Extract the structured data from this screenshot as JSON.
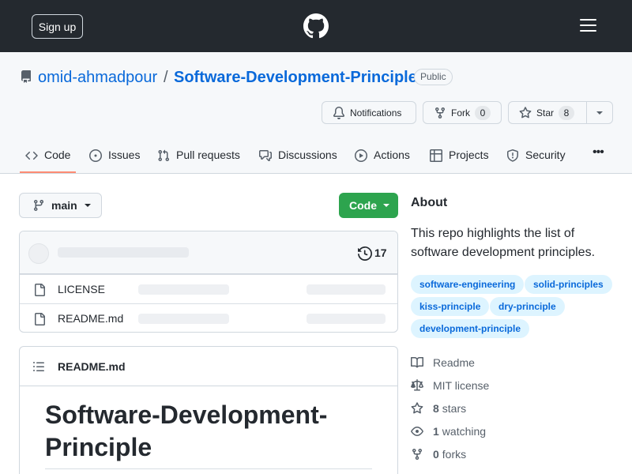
{
  "header": {
    "signup_label": "Sign up",
    "logo_icon": "github-mark-icon",
    "menu_icon": "hamburger-icon"
  },
  "repo": {
    "owner": "omid-ahmadpour",
    "separator": "/",
    "name": "Software-Development-Principle",
    "visibility": "Public"
  },
  "actions": {
    "notifications_label": "Notifications",
    "fork_label": "Fork",
    "fork_count": "0",
    "star_label": "Star",
    "star_count": "8"
  },
  "tabs": [
    {
      "label": "Code",
      "icon": "code-icon",
      "selected": true
    },
    {
      "label": "Issues",
      "icon": "issue-icon"
    },
    {
      "label": "Pull requests",
      "icon": "pull-request-icon"
    },
    {
      "label": "Discussions",
      "icon": "discussions-icon"
    },
    {
      "label": "Actions",
      "icon": "play-icon"
    },
    {
      "label": "Projects",
      "icon": "table-icon"
    },
    {
      "label": "Security",
      "icon": "shield-icon"
    },
    {
      "label": "•••",
      "icon": "kebab-icon"
    }
  ],
  "branch": {
    "name": "main"
  },
  "code_button_label": "Code",
  "commits": {
    "count": "17"
  },
  "files": [
    {
      "name": "LICENSE"
    },
    {
      "name": "README.md"
    }
  ],
  "readme": {
    "filename": "README.md",
    "heading": "Software-Development-Principle"
  },
  "about": {
    "heading": "About",
    "description": "This repo highlights the list of software development principles.",
    "topics": [
      "software-engineering",
      "solid-principles",
      "kiss-principle",
      "dry-principle",
      "development-principle"
    ],
    "readme_label": "Readme",
    "license_label": "MIT license",
    "stars_count": "8",
    "stars_label": "stars",
    "watching_count": "1",
    "watching_label": "watching",
    "forks_count": "0",
    "forks_label": "forks"
  },
  "colors": {
    "header_bg": "#24292f",
    "link": "#0969da",
    "primary_button": "#2da44e",
    "tab_underline": "#fd8c73",
    "topic_bg": "#ddf4ff"
  }
}
